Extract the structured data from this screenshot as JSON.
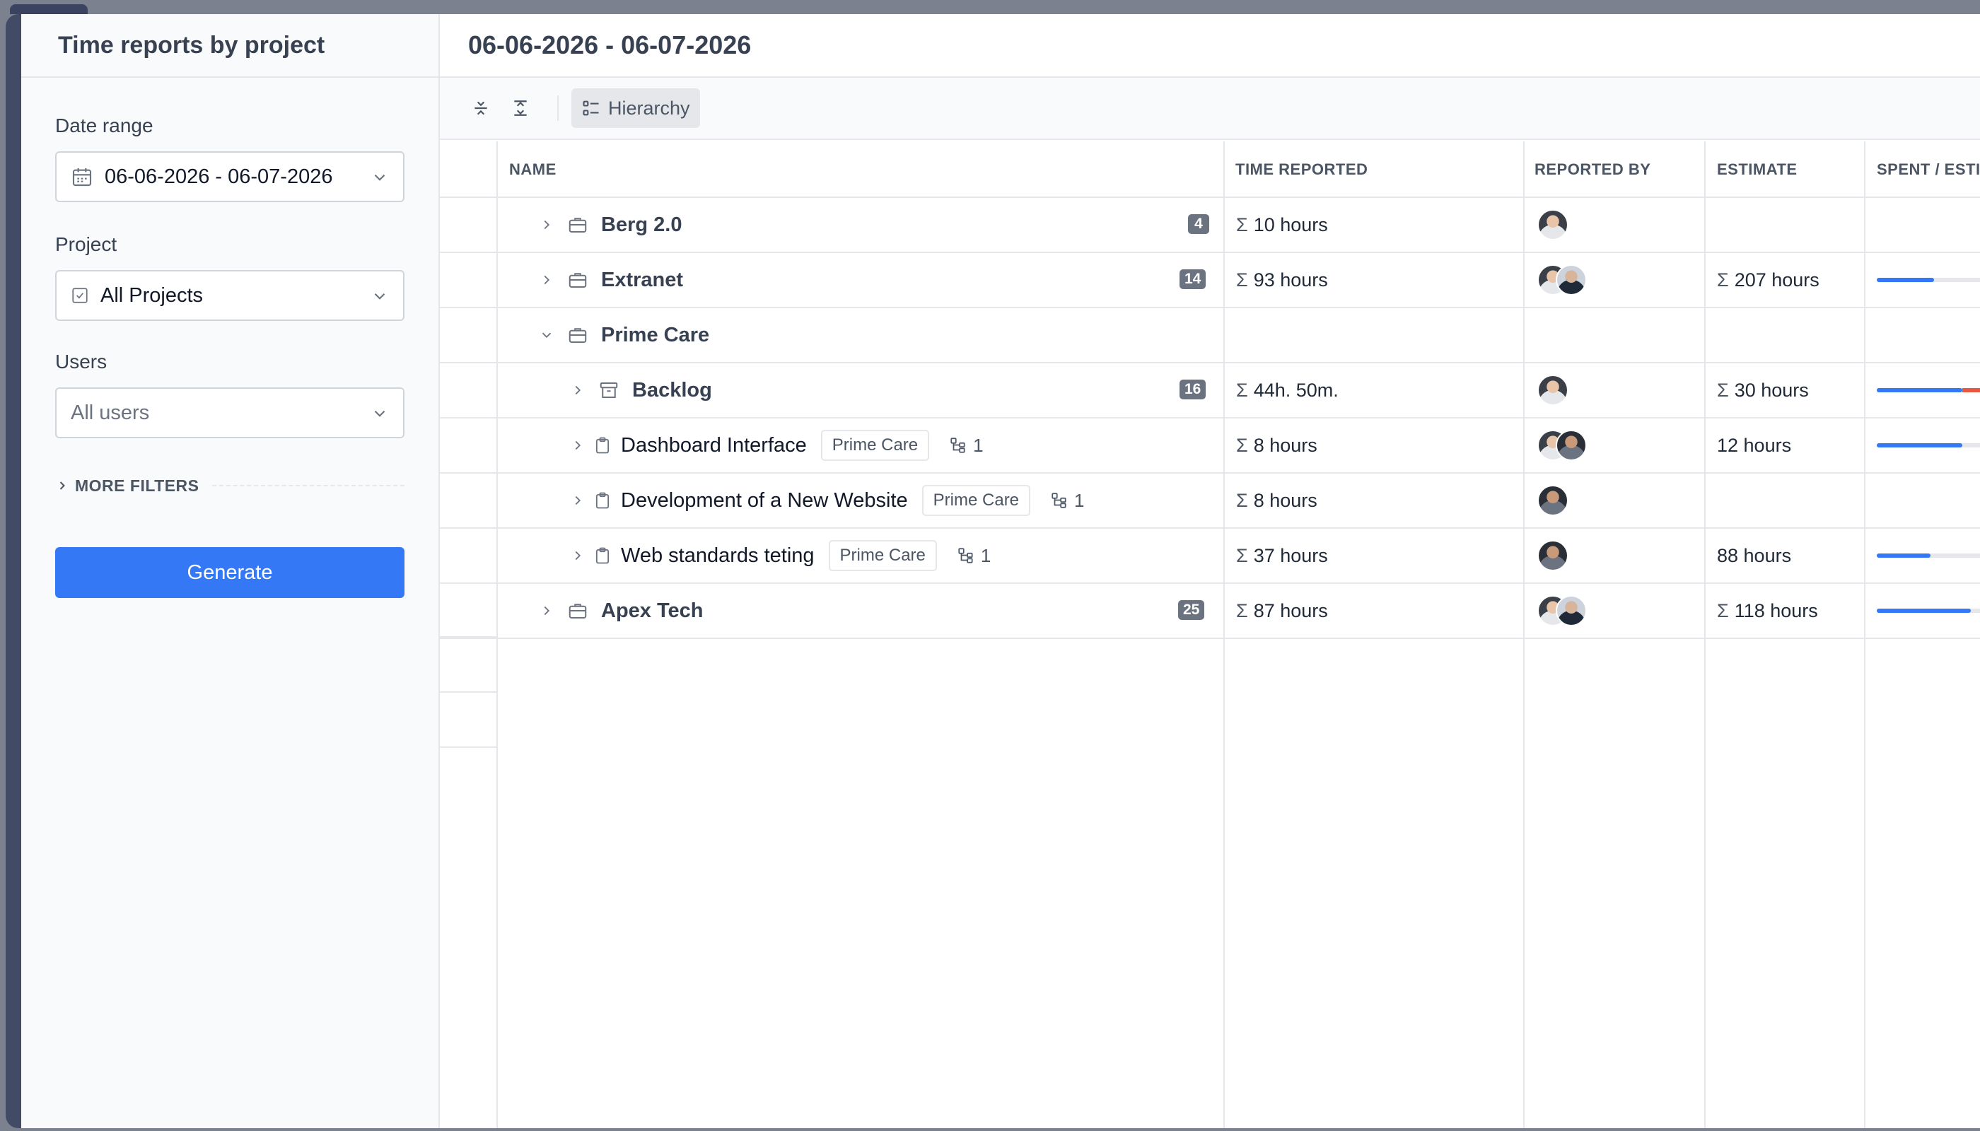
{
  "sidebar": {
    "title": "Time reports by project",
    "date_range_label": "Date range",
    "date_range_value": "06-06-2026 - 06-07-2026",
    "project_label": "Project",
    "project_value": "All Projects",
    "users_label": "Users",
    "users_placeholder": "All users",
    "more_filters_label": "MORE FILTERS",
    "generate_label": "Generate"
  },
  "main": {
    "title": "06-06-2026 - 06-07-2026",
    "toolbar": {
      "hierarchy_label": "Hierarchy"
    }
  },
  "table": {
    "columns": {
      "name": "NAME",
      "time_reported": "TIME REPORTED",
      "reported_by": "REPORTED BY",
      "estimate": "ESTIMATE",
      "spent_estimate": "SPENT / ESTIMA"
    },
    "rows": [
      {
        "name": "Berg 2.0",
        "badge": "4",
        "time": "10 hours",
        "estimate": "",
        "progress": null
      },
      {
        "name": "Extranet",
        "badge": "14",
        "time": "93 hours",
        "estimate": "207 hours",
        "progress": 0.45
      },
      {
        "name": "Prime Care",
        "badge": "",
        "time": "",
        "estimate": "",
        "progress": null
      },
      {
        "name": "Backlog",
        "badge": "16",
        "time": "44h. 50m.",
        "estimate": "30 hours",
        "progress": 1.49
      },
      {
        "name": "Dashboard Interface",
        "tag": "Prime Care",
        "subtasks": "1",
        "time": "8 hours",
        "estimate": "12 hours",
        "progress": 0.67
      },
      {
        "name": "Development of a New Website",
        "tag": "Prime Care",
        "subtasks": "1",
        "time": "8 hours",
        "estimate": "",
        "progress": null
      },
      {
        "name": "Web standards teting",
        "tag": "Prime Care",
        "subtasks": "1",
        "time": "37 hours",
        "estimate": "88 hours",
        "progress": 0.42
      },
      {
        "name": "Apex Tech",
        "badge": "25",
        "time": "87 hours",
        "estimate": "118 hours",
        "progress": 0.74
      }
    ]
  },
  "colors": {
    "accent": "#3478f6",
    "over_budget": "#e8573f",
    "badge": "#6b7280"
  }
}
